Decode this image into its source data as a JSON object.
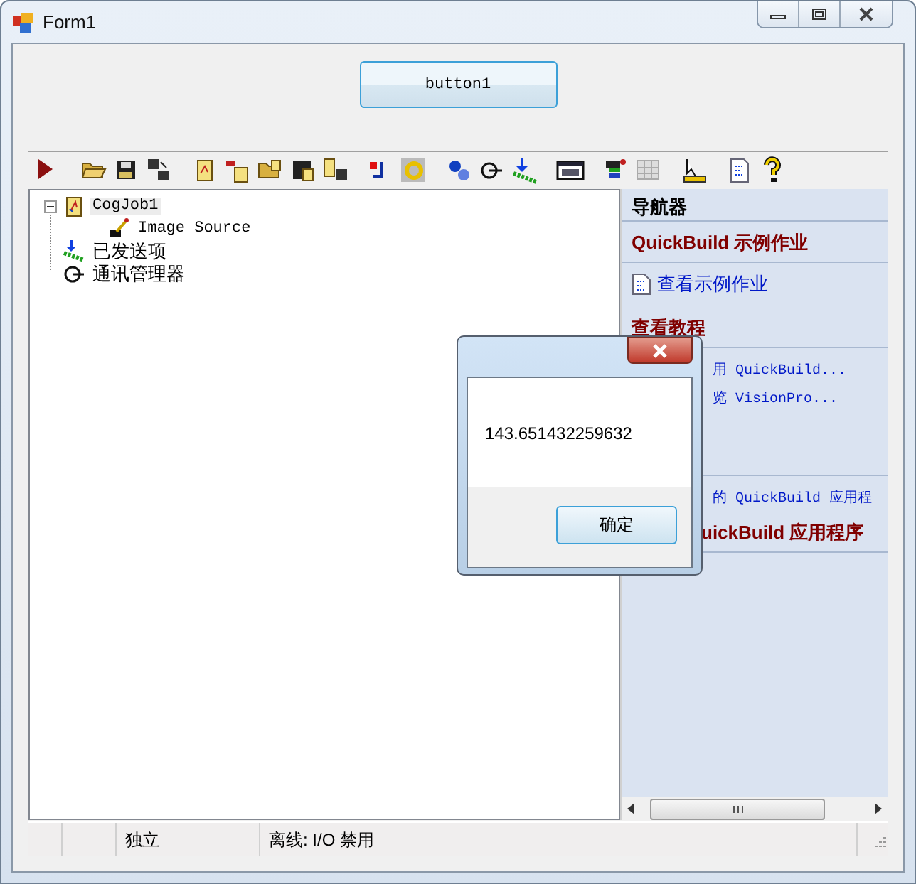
{
  "window": {
    "title": "Form1"
  },
  "button": "button1",
  "tree": [
    {
      "label": "CogJob1",
      "selected": true,
      "expanded": true,
      "children": [
        {
          "label": "Image Source",
          "selected": false
        }
      ]
    },
    {
      "label": "已发送项",
      "selected": false
    },
    {
      "label": "通讯管理器",
      "selected": false
    }
  ],
  "navigator": {
    "title": "导航器",
    "sections": [
      {
        "heading": "QuickBuild 示例作业",
        "links": [
          {
            "text": "查看示例作业"
          }
        ]
      },
      {
        "heading": "查看教程",
        "links": [
          {
            "text": "用 QuickBuild..."
          },
          {
            "text": "览 VisionPro..."
          }
        ]
      },
      {
        "links": [
          {
            "text": "的 QuickBuild 应用程"
          }
        ]
      },
      {
        "heading": "uickBuild 应用程序"
      }
    ]
  },
  "status_bar": [
    "独立",
    "离线: I/O 禁用"
  ],
  "dialog": {
    "message": "143.651432259632",
    "button": "确定"
  }
}
